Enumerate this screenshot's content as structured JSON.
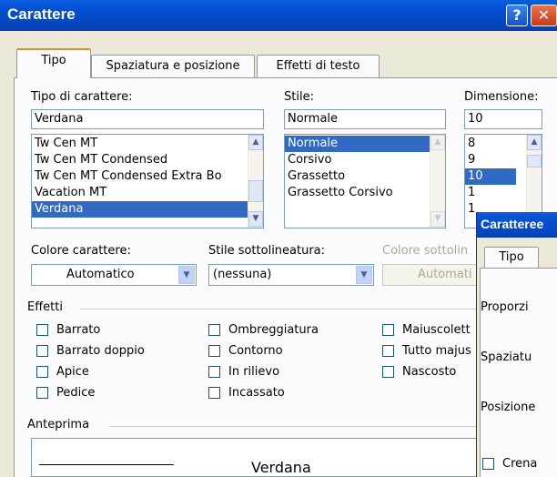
{
  "window": {
    "title": "Carattere",
    "help_glyph": "?",
    "close_glyph": "✕"
  },
  "tabs": [
    {
      "label": "Tipo",
      "active": true
    },
    {
      "label": "Spaziatura e posizione",
      "active": false
    },
    {
      "label": "Effetti di testo",
      "active": false
    }
  ],
  "font": {
    "label": "Tipo di carattere:",
    "value": "Verdana",
    "items": [
      "Tw Cen MT",
      "Tw Cen MT Condensed",
      "Tw Cen MT Condensed Extra Bo",
      "Vacation MT",
      "Verdana"
    ],
    "selected_index": 4
  },
  "style": {
    "label": "Stile:",
    "value": "Normale",
    "items": [
      "Normale",
      "Corsivo",
      "Grassetto",
      "Grassetto Corsivo"
    ],
    "selected_index": 0
  },
  "size": {
    "label": "Dimensione:",
    "value": "10",
    "items": [
      "8",
      "9",
      "10",
      "1",
      "1"
    ],
    "selected_index": 2
  },
  "color": {
    "label": "Colore carattere:",
    "value": "Automatico"
  },
  "underline": {
    "label": "Stile sottolineatura:",
    "value": "(nessuna)"
  },
  "underline_color": {
    "label": "Colore sottolin",
    "value": "Automati"
  },
  "effects": {
    "label": "Effetti",
    "col1": [
      "Barrato",
      "Barrato doppio",
      "Apice",
      "Pedice"
    ],
    "col2": [
      "Ombreggiatura",
      "Contorno",
      "In rilievo",
      "Incassato"
    ],
    "col3": [
      "Maiuscolett",
      "Tutto majus",
      "Nascosto"
    ]
  },
  "preview": {
    "label": "Anteprima",
    "text": "Verdana"
  },
  "dialog2": {
    "title": "Caratteree",
    "tab": "Tipo",
    "labels": [
      "Proporzi",
      "Spaziatu",
      "Posizione",
      "Crena"
    ]
  },
  "scroll_glyphs": {
    "up": "▲",
    "down": "▼"
  },
  "colors": {
    "titlebar": "#0453d6",
    "selection": "#316ac5",
    "tab_accent": "#e68b2c",
    "face": "#ece9d8"
  }
}
